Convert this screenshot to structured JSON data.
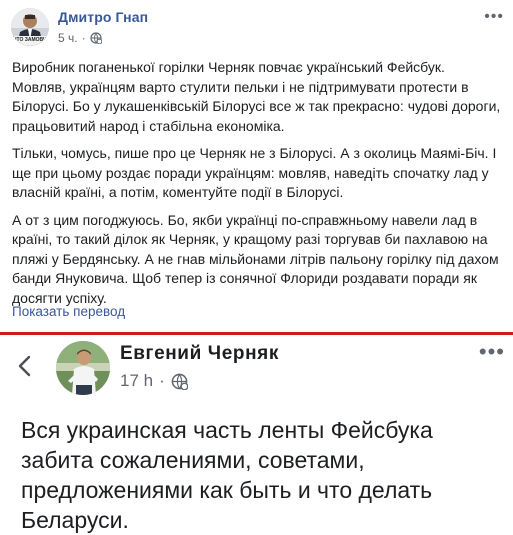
{
  "post_top": {
    "author": "Дмитро Гнап",
    "time": "5 ч.",
    "audience_icon": "globe-gear-icon",
    "more_icon": "ellipsis-icon",
    "avatar_caption": "ЧТО ЗАМОВЧ",
    "paragraphs": [
      "Виробник поганенької горілки Черняк повчає український Фейсбук. Мовляв, українцям варто стулити пельки і не підтримувати протести в Білорусі. Бо у лукашенківській Білорусі все ж так прекрасно: чудові дороги, працьовитий народ і стабільна економіка.",
      "Тільки, чомусь, пише про це Черняк не з Білорусі. А з околиць Маямі-Біч. І ще при цьому роздає поради українцям: мовляв, наведіть спочатку лад у власній країні, а потім, коментуйте події в Білорусі.",
      "А от з цим погоджуюсь. Бо, якби українці по-справжньому навели лад в країні, то такий ділок як Черняк, у кращому разі торгував би пахлавою на пляжі у Бердянську. А не гнав мільйонами літрів пальону горілку під дахом банди Януковича. Щоб тепер із сонячної Флориди роздавати поради як досягти успіху."
    ],
    "translate_link": "Показать перевод"
  },
  "post_bottom": {
    "author": "Евгений Черняк",
    "time": "17 h",
    "audience_icon": "globe-gear-icon",
    "back_icon": "chevron-left-icon",
    "more_icon": "ellipsis-icon",
    "text": "Вся украинская часть ленты Фейсбука забита сожалениями, советами, предложениями как быть и что делать Беларуси."
  },
  "colors": {
    "link": "#385898",
    "separator": "#d11b1b",
    "meta": "#616770"
  }
}
